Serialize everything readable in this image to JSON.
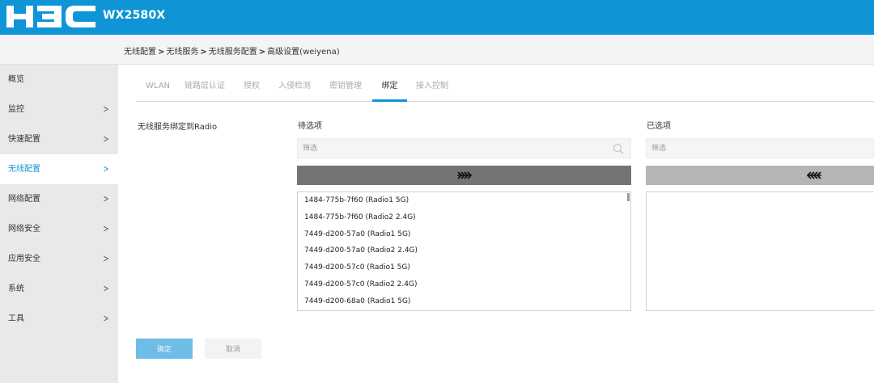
{
  "header": {
    "logo_text": "H3C",
    "model": "WX2580X",
    "brand_color": "#0f95d6"
  },
  "breadcrumb": {
    "items": [
      "无线配置",
      "无线服务",
      "无线服务配置",
      "高级设置(weiyena)"
    ],
    "separator": ">"
  },
  "sidebar": {
    "items": [
      {
        "label": "概览",
        "has_arrow": false,
        "active": false
      },
      {
        "label": "监控",
        "has_arrow": true,
        "active": false
      },
      {
        "label": "快速配置",
        "has_arrow": true,
        "active": false
      },
      {
        "label": "无线配置",
        "has_arrow": true,
        "active": true
      },
      {
        "label": "网络配置",
        "has_arrow": true,
        "active": false
      },
      {
        "label": "网络安全",
        "has_arrow": true,
        "active": false
      },
      {
        "label": "应用安全",
        "has_arrow": true,
        "active": false
      },
      {
        "label": "系统",
        "has_arrow": true,
        "active": false
      },
      {
        "label": "工具",
        "has_arrow": true,
        "active": false
      }
    ],
    "arrow_icon": "chevron-right-icon"
  },
  "tabs": [
    {
      "label": "WLAN",
      "active": false
    },
    {
      "label": "链路层认证",
      "active": false
    },
    {
      "label": "授权",
      "active": false
    },
    {
      "label": "入侵检测",
      "active": false
    },
    {
      "label": "密钥管理",
      "active": false
    },
    {
      "label": "绑定",
      "active": true
    },
    {
      "label": "接入控制",
      "active": false
    }
  ],
  "form": {
    "field_label": "无线服务绑定到Radio",
    "available": {
      "title": "待选项",
      "filter_placeholder": "筛选",
      "move_icon": "double-arrow-right-icon",
      "items": [
        "1484-775b-7f60 (Radio1 5G)",
        "1484-775b-7f60 (Radio2 2.4G)",
        "7449-d200-57a0 (Radio1 5G)",
        "7449-d200-57a0 (Radio2 2.4G)",
        "7449-d200-57c0 (Radio1 5G)",
        "7449-d200-57c0 (Radio2 2.4G)",
        "7449-d200-68a0 (Radio1 5G)"
      ]
    },
    "selected": {
      "title": "已选项",
      "filter_placeholder": "筛选",
      "move_icon": "double-arrow-left-icon",
      "items": []
    }
  },
  "actions": {
    "ok_label": "确定",
    "cancel_label": "取消"
  }
}
